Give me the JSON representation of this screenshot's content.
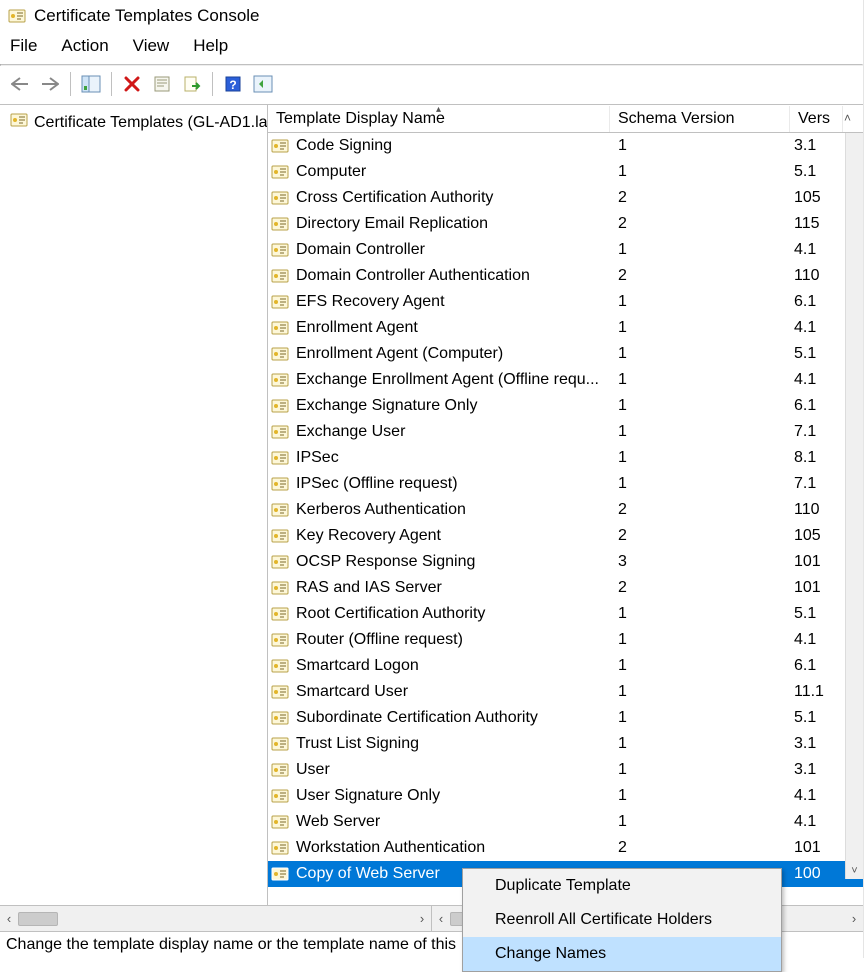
{
  "window_title": "Certificate Templates Console",
  "menu": {
    "file": "File",
    "action": "Action",
    "view": "View",
    "help": "Help"
  },
  "tree": {
    "root": "Certificate Templates (GL-AD1.la"
  },
  "columns": {
    "name": "Template Display Name",
    "schema": "Schema Version",
    "vers": "Vers"
  },
  "rows": [
    {
      "name": "Code Signing",
      "schema": "1",
      "vers": "3.1"
    },
    {
      "name": "Computer",
      "schema": "1",
      "vers": "5.1"
    },
    {
      "name": "Cross Certification Authority",
      "schema": "2",
      "vers": "105"
    },
    {
      "name": "Directory Email Replication",
      "schema": "2",
      "vers": "115"
    },
    {
      "name": "Domain Controller",
      "schema": "1",
      "vers": "4.1"
    },
    {
      "name": "Domain Controller Authentication",
      "schema": "2",
      "vers": "110"
    },
    {
      "name": "EFS Recovery Agent",
      "schema": "1",
      "vers": "6.1"
    },
    {
      "name": "Enrollment Agent",
      "schema": "1",
      "vers": "4.1"
    },
    {
      "name": "Enrollment Agent (Computer)",
      "schema": "1",
      "vers": "5.1"
    },
    {
      "name": "Exchange Enrollment Agent (Offline requ...",
      "schema": "1",
      "vers": "4.1"
    },
    {
      "name": "Exchange Signature Only",
      "schema": "1",
      "vers": "6.1"
    },
    {
      "name": "Exchange User",
      "schema": "1",
      "vers": "7.1"
    },
    {
      "name": "IPSec",
      "schema": "1",
      "vers": "8.1"
    },
    {
      "name": "IPSec (Offline request)",
      "schema": "1",
      "vers": "7.1"
    },
    {
      "name": "Kerberos Authentication",
      "schema": "2",
      "vers": "110"
    },
    {
      "name": "Key Recovery Agent",
      "schema": "2",
      "vers": "105"
    },
    {
      "name": "OCSP Response Signing",
      "schema": "3",
      "vers": "101"
    },
    {
      "name": "RAS and IAS Server",
      "schema": "2",
      "vers": "101"
    },
    {
      "name": "Root Certification Authority",
      "schema": "1",
      "vers": "5.1"
    },
    {
      "name": "Router (Offline request)",
      "schema": "1",
      "vers": "4.1"
    },
    {
      "name": "Smartcard Logon",
      "schema": "1",
      "vers": "6.1"
    },
    {
      "name": "Smartcard User",
      "schema": "1",
      "vers": "11.1"
    },
    {
      "name": "Subordinate Certification Authority",
      "schema": "1",
      "vers": "5.1"
    },
    {
      "name": "Trust List Signing",
      "schema": "1",
      "vers": "3.1"
    },
    {
      "name": "User",
      "schema": "1",
      "vers": "3.1"
    },
    {
      "name": "User Signature Only",
      "schema": "1",
      "vers": "4.1"
    },
    {
      "name": "Web Server",
      "schema": "1",
      "vers": "4.1"
    },
    {
      "name": "Workstation Authentication",
      "schema": "2",
      "vers": "101"
    },
    {
      "name": "Copy of Web Server",
      "schema": "",
      "vers": "100",
      "selected": true
    }
  ],
  "context_menu": {
    "items": [
      {
        "label": "Duplicate Template"
      },
      {
        "label": "Reenroll All Certificate Holders"
      },
      {
        "label": "Change Names",
        "hl": true
      }
    ]
  },
  "status": "Change the template display name or the template name of this"
}
